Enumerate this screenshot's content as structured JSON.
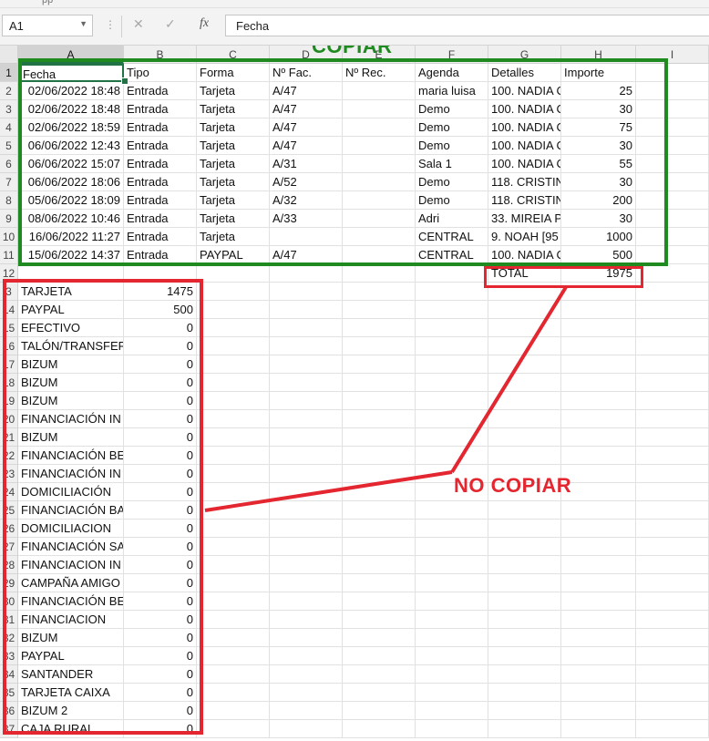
{
  "titlebar_text": "pp",
  "formula_bar": {
    "name_box": "A1",
    "cancel_icon": "✕",
    "enter_icon": "✓",
    "fx_label": "fx",
    "content": "Fecha"
  },
  "columns": [
    "A",
    "B",
    "C",
    "D",
    "E",
    "F",
    "G",
    "H",
    "I"
  ],
  "row_numbers": [
    "1",
    "2",
    "3",
    "4",
    "5",
    "6",
    "7",
    "8",
    "9",
    "10",
    "11",
    "12",
    "3",
    "14",
    "15",
    "16",
    "17",
    "18",
    "19",
    "20",
    "21",
    "22",
    "23",
    "24",
    "25",
    "26",
    "27",
    "28",
    "29",
    "30",
    "31",
    "32",
    "33",
    "34",
    "35",
    "36",
    "37"
  ],
  "headers": [
    "Fecha",
    "Tipo",
    "Forma",
    "Nº Fac.",
    "Nº Rec.",
    "Agenda",
    "Detalles",
    "Importe"
  ],
  "rows": [
    [
      "02/06/2022 18:48",
      "Entrada",
      "Tarjeta",
      "A/47",
      "",
      "maria luisa",
      "100. NADIA C",
      "25"
    ],
    [
      "02/06/2022 18:48",
      "Entrada",
      "Tarjeta",
      "A/47",
      "",
      "Demo",
      "100. NADIA C",
      "30"
    ],
    [
      "02/06/2022 18:59",
      "Entrada",
      "Tarjeta",
      "A/47",
      "",
      "Demo",
      "100. NADIA C",
      "75"
    ],
    [
      "06/06/2022 12:43",
      "Entrada",
      "Tarjeta",
      "A/47",
      "",
      "Demo",
      "100. NADIA C",
      "30"
    ],
    [
      "06/06/2022 15:07",
      "Entrada",
      "Tarjeta",
      "A/31",
      "",
      "Sala 1",
      "100. NADIA C",
      "55"
    ],
    [
      "06/06/2022 18:06",
      "Entrada",
      "Tarjeta",
      "A/52",
      "",
      "Demo",
      "118. CRISTINA",
      "30"
    ],
    [
      "05/06/2022 18:09",
      "Entrada",
      "Tarjeta",
      "A/32",
      "",
      "Demo",
      "118. CRISTINA",
      "200"
    ],
    [
      "08/06/2022 10:46",
      "Entrada",
      "Tarjeta",
      "A/33",
      "",
      "Adri",
      "33. MIREIA P",
      "30"
    ],
    [
      "16/06/2022 11:27",
      "Entrada",
      "Tarjeta",
      "",
      "",
      "CENTRAL",
      "9. NOAH  [95",
      "1000"
    ],
    [
      "15/06/2022 14:37",
      "Entrada",
      "PAYPAL",
      "A/47",
      "",
      "CENTRAL",
      "100. NADIA C",
      "500"
    ]
  ],
  "total": {
    "label": "TOTAL",
    "value": "1975"
  },
  "summary": [
    {
      "name": "TARJETA",
      "value": "1475"
    },
    {
      "name": "PAYPAL",
      "value": "500"
    },
    {
      "name": "EFECTIVO",
      "value": "0"
    },
    {
      "name": "TALÓN/TRANSFER",
      "value": "0"
    },
    {
      "name": "BIZUM",
      "value": "0"
    },
    {
      "name": "BIZUM",
      "value": "0"
    },
    {
      "name": "BIZUM",
      "value": "0"
    },
    {
      "name": "FINANCIACIÓN IN",
      "value": "0"
    },
    {
      "name": "BIZUM",
      "value": "0"
    },
    {
      "name": "FINANCIACIÓN BE",
      "value": "0"
    },
    {
      "name": "FINANCIACIÓN IN",
      "value": "0"
    },
    {
      "name": "DOMICILIACIÓN",
      "value": "0"
    },
    {
      "name": "FINANCIACIÓN BA",
      "value": "0"
    },
    {
      "name": "DOMICILIACION",
      "value": "0"
    },
    {
      "name": "FINANCIACIÓN SA",
      "value": "0"
    },
    {
      "name": "FINANCIACION IN",
      "value": "0"
    },
    {
      "name": "CAMPAÑA AMIGO",
      "value": "0"
    },
    {
      "name": "FINANCIACIÓN BE",
      "value": "0"
    },
    {
      "name": "FINANCIACION",
      "value": "0"
    },
    {
      "name": "BIZUM",
      "value": "0"
    },
    {
      "name": "PAYPAL",
      "value": "0"
    },
    {
      "name": "SANTANDER",
      "value": "0"
    },
    {
      "name": "TARJETA CAIXA",
      "value": "0"
    },
    {
      "name": "BIZUM 2",
      "value": "0"
    },
    {
      "name": "CAJA RURAL",
      "value": "0"
    }
  ],
  "annotations": {
    "copy_label": "COPIAR",
    "no_copy_label": "NO COPIAR",
    "copy_color": "#1f8a1f",
    "no_copy_color": "#e3262f"
  },
  "accent_color": "#217346"
}
